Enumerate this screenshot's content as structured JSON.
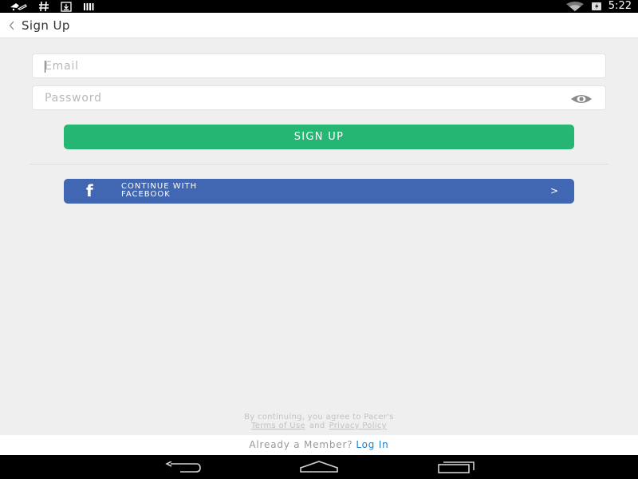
{
  "status_bar": {
    "time": "5:22",
    "left_icons": [
      "notification-icon",
      "hash-icon",
      "download-icon",
      "barcode-icon"
    ],
    "right_icons": [
      "wifi-icon",
      "battery-icon"
    ]
  },
  "app_bar": {
    "title": "Sign Up",
    "back_icon": "chevron-left-icon"
  },
  "form": {
    "email_placeholder": "Email",
    "email_value": "",
    "password_placeholder": "Password",
    "password_value": "",
    "show_password_icon": "eye-icon",
    "signup_label": "SIGN UP"
  },
  "facebook": {
    "logo": "f",
    "label_line1": "CONTINUE WITH",
    "label_line2": "FACEBOOK",
    "arrow": ">"
  },
  "legal": {
    "prefix": "By continuing, you agree to Pacer's",
    "terms": "Terms of Use",
    "and": "and",
    "privacy": "Privacy Policy"
  },
  "footer": {
    "question": "Already a Member?",
    "login_label": "Log In"
  },
  "colors": {
    "background": "#efefef",
    "signup_green": "#25b673",
    "facebook_blue": "#4267b2",
    "link_blue": "#1f7ec7"
  },
  "nav_bar": {
    "icons": [
      "back-nav-icon",
      "home-nav-icon",
      "recents-nav-icon"
    ]
  }
}
